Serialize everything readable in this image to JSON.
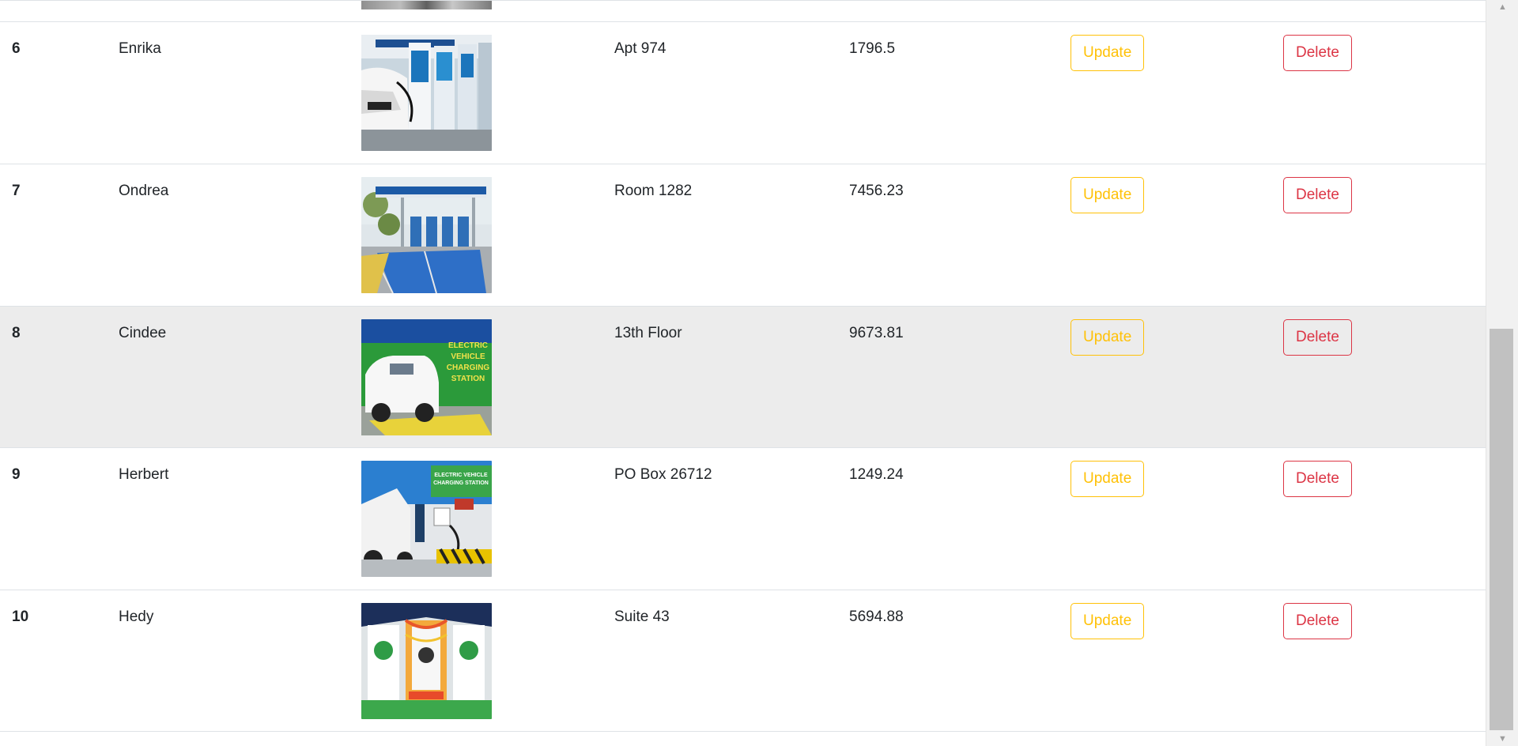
{
  "table": {
    "rows": [
      {
        "id": "6",
        "name": "Enrika",
        "address": "Apt 974",
        "price": "1796.5",
        "image_icon": "ev-charging-station-photo",
        "highlighted": false
      },
      {
        "id": "7",
        "name": "Ondrea",
        "address": "Room 1282",
        "price": "7456.23",
        "image_icon": "ev-charging-station-photo",
        "highlighted": false
      },
      {
        "id": "8",
        "name": "Cindee",
        "address": "13th Floor",
        "price": "9673.81",
        "image_icon": "ev-charging-station-photo",
        "highlighted": true
      },
      {
        "id": "9",
        "name": "Herbert",
        "address": "PO Box 26712",
        "price": "1249.24",
        "image_icon": "ev-charging-station-photo",
        "highlighted": false
      },
      {
        "id": "10",
        "name": "Hedy",
        "address": "Suite 43",
        "price": "5694.88",
        "image_icon": "ev-charging-station-photo",
        "highlighted": false
      }
    ],
    "update_label": "Update",
    "delete_label": "Delete"
  },
  "thumbnail_text": {
    "row8": [
      "ELECTRIC",
      "VEHICLE",
      "CHARGING",
      "STATION"
    ],
    "row9": [
      "ELECTRIC VEHICLE",
      "CHARGING STATION"
    ]
  },
  "colors": {
    "update": "#ffc107",
    "delete": "#dc3545",
    "hover_row": "#ececec",
    "border": "#dee2e6"
  }
}
